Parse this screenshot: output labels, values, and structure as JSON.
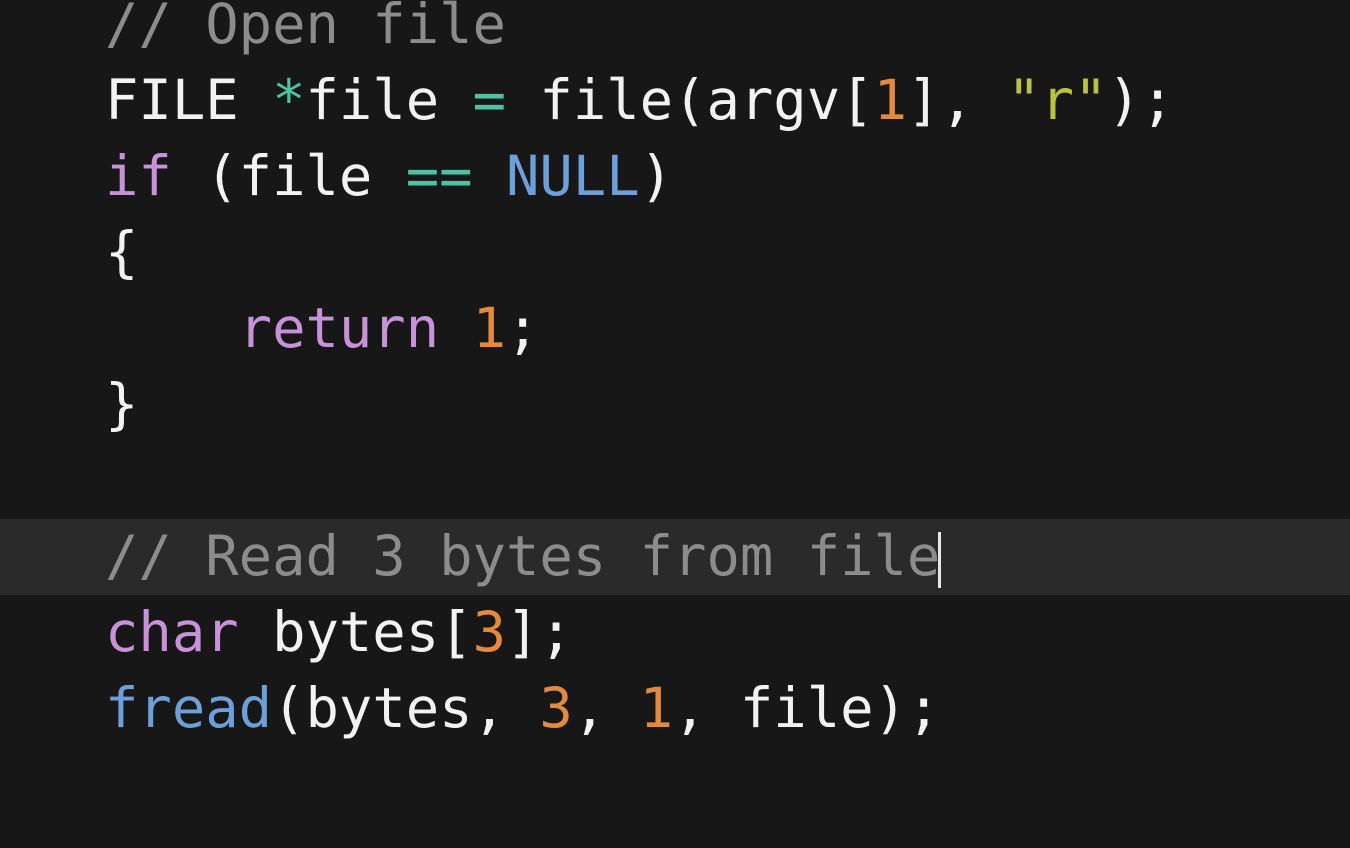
{
  "editor": {
    "current_line": 7,
    "lines": [
      [
        {
          "t": "comment",
          "v": "// Open file"
        }
      ],
      [
        {
          "t": "plain",
          "v": "FILE "
        },
        {
          "t": "operator",
          "v": "*"
        },
        {
          "t": "plain",
          "v": "file "
        },
        {
          "t": "operator",
          "v": "="
        },
        {
          "t": "plain",
          "v": " file(argv["
        },
        {
          "t": "number",
          "v": "1"
        },
        {
          "t": "plain",
          "v": "], "
        },
        {
          "t": "string",
          "v": "\"r\""
        },
        {
          "t": "plain",
          "v": ");"
        }
      ],
      [
        {
          "t": "keyword",
          "v": "if"
        },
        {
          "t": "plain",
          "v": " (file "
        },
        {
          "t": "operator",
          "v": "=="
        },
        {
          "t": "plain",
          "v": " "
        },
        {
          "t": "constant",
          "v": "NULL"
        },
        {
          "t": "plain",
          "v": ")"
        }
      ],
      [
        {
          "t": "plain",
          "v": "{"
        }
      ],
      [
        {
          "t": "plain",
          "v": "    "
        },
        {
          "t": "keyword",
          "v": "return"
        },
        {
          "t": "plain",
          "v": " "
        },
        {
          "t": "number",
          "v": "1"
        },
        {
          "t": "plain",
          "v": ";"
        }
      ],
      [
        {
          "t": "plain",
          "v": "}"
        }
      ],
      [],
      [
        {
          "t": "comment",
          "v": "// Read 3 bytes from file"
        }
      ],
      [
        {
          "t": "keyword",
          "v": "char"
        },
        {
          "t": "plain",
          "v": " bytes["
        },
        {
          "t": "number",
          "v": "3"
        },
        {
          "t": "plain",
          "v": "];"
        }
      ],
      [
        {
          "t": "function",
          "v": "fread"
        },
        {
          "t": "plain",
          "v": "(bytes, "
        },
        {
          "t": "number",
          "v": "3"
        },
        {
          "t": "plain",
          "v": ", "
        },
        {
          "t": "number",
          "v": "1"
        },
        {
          "t": "plain",
          "v": ", file);"
        }
      ],
      []
    ]
  }
}
